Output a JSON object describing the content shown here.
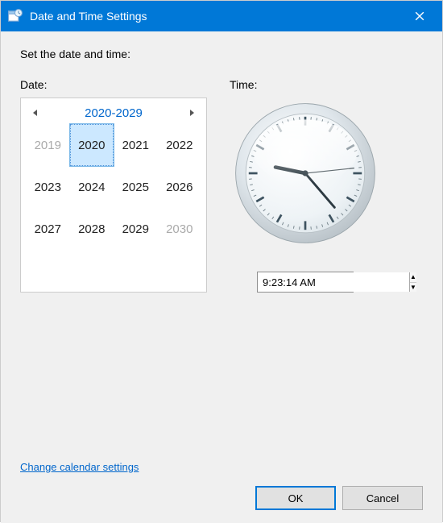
{
  "window": {
    "title": "Date and Time Settings",
    "close_label": "Close"
  },
  "heading": "Set the date and time:",
  "labels": {
    "date": "Date:",
    "time": "Time:"
  },
  "calendar": {
    "range_title": "2020-2029",
    "prev": "Previous decade",
    "next": "Next decade",
    "years": [
      {
        "label": "2019",
        "out": true,
        "sel": false
      },
      {
        "label": "2020",
        "out": false,
        "sel": true
      },
      {
        "label": "2021",
        "out": false,
        "sel": false
      },
      {
        "label": "2022",
        "out": false,
        "sel": false
      },
      {
        "label": "2023",
        "out": false,
        "sel": false
      },
      {
        "label": "2024",
        "out": false,
        "sel": false
      },
      {
        "label": "2025",
        "out": false,
        "sel": false
      },
      {
        "label": "2026",
        "out": false,
        "sel": false
      },
      {
        "label": "2027",
        "out": false,
        "sel": false
      },
      {
        "label": "2028",
        "out": false,
        "sel": false
      },
      {
        "label": "2029",
        "out": false,
        "sel": false
      },
      {
        "label": "2030",
        "out": true,
        "sel": false
      }
    ]
  },
  "time": {
    "display": "9:23:14 AM",
    "hours": 9,
    "minutes": 23,
    "seconds": 14
  },
  "link": "Change calendar settings",
  "buttons": {
    "ok": "OK",
    "cancel": "Cancel"
  }
}
